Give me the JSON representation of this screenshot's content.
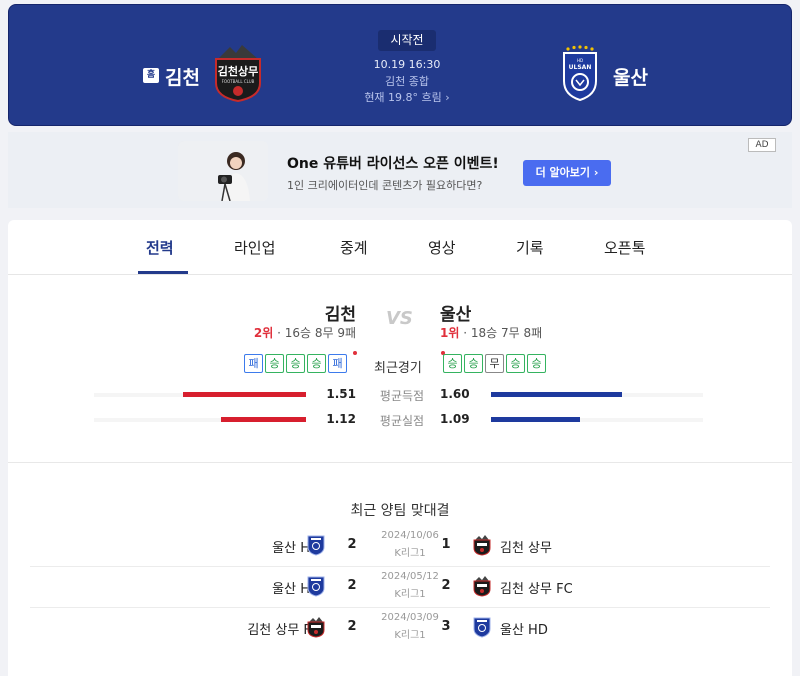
{
  "match": {
    "home_badge": "홈",
    "home_name": "김천",
    "away_name": "울산",
    "status": "시작전",
    "datetime": "10.19 16:30",
    "venue": "김천 종합",
    "weather": "현재 19.8° 흐림 ›",
    "home_logo_text": "김천상무",
    "home_logo_sub": "FOOTBALL CLUB",
    "away_logo_text": "ULSAN",
    "away_logo_sub": "HD"
  },
  "ad": {
    "badge": "AD",
    "title": "One 유튜버 라이선스 오픈 이벤트!",
    "subtitle": "1인 크리에이터인데 콘텐츠가 필요하다면?",
    "button": "더 알아보기 ›"
  },
  "tabs": [
    "전력",
    "라인업",
    "중계",
    "영상",
    "기록",
    "오픈톡"
  ],
  "compare": {
    "home": {
      "name": "김천",
      "rank": "2위",
      "record": " · 16승 8무 9패",
      "form": [
        "패",
        "승",
        "승",
        "승",
        "패"
      ],
      "goals_for": "1.51",
      "goals_against": "1.12"
    },
    "away": {
      "name": "울산",
      "rank": "1위",
      "record": " · 18승 7무 8패",
      "form": [
        "승",
        "승",
        "무",
        "승",
        "승"
      ],
      "goals_for": "1.60",
      "goals_against": "1.09"
    },
    "vs": "VS",
    "form_label": "최근경기",
    "goals_for_label": "평균득점",
    "goals_against_label": "평균실점",
    "goals_for_level": {
      "home": 0.58,
      "away": 0.62
    },
    "goals_against_level": {
      "home": 0.4,
      "away": 0.42
    }
  },
  "h2h": {
    "title": "최근 양팀 맞대결",
    "rows": [
      {
        "home": "울산 HD",
        "home_club": "ulsan",
        "home_score": "2",
        "date": "2024/10/06",
        "league": "K리그1",
        "away_score": "1",
        "away": "김천 상무",
        "away_club": "gimcheon"
      },
      {
        "home": "울산 HD",
        "home_club": "ulsan",
        "home_score": "2",
        "date": "2024/05/12",
        "league": "K리그1",
        "away_score": "2",
        "away": "김천 상무 FC",
        "away_club": "gimcheon"
      },
      {
        "home": "김천 상무 FC",
        "home_club": "gimcheon",
        "home_score": "2",
        "date": "2024/03/09",
        "league": "K리그1",
        "away_score": "3",
        "away": "울산 HD",
        "away_club": "ulsan"
      }
    ]
  },
  "colors": {
    "header_bg": "#233a8b",
    "home_bar": "#d71f2e",
    "away_bar": "#1e3a9e",
    "win": "#1f9d46",
    "loss": "#2563d8"
  }
}
